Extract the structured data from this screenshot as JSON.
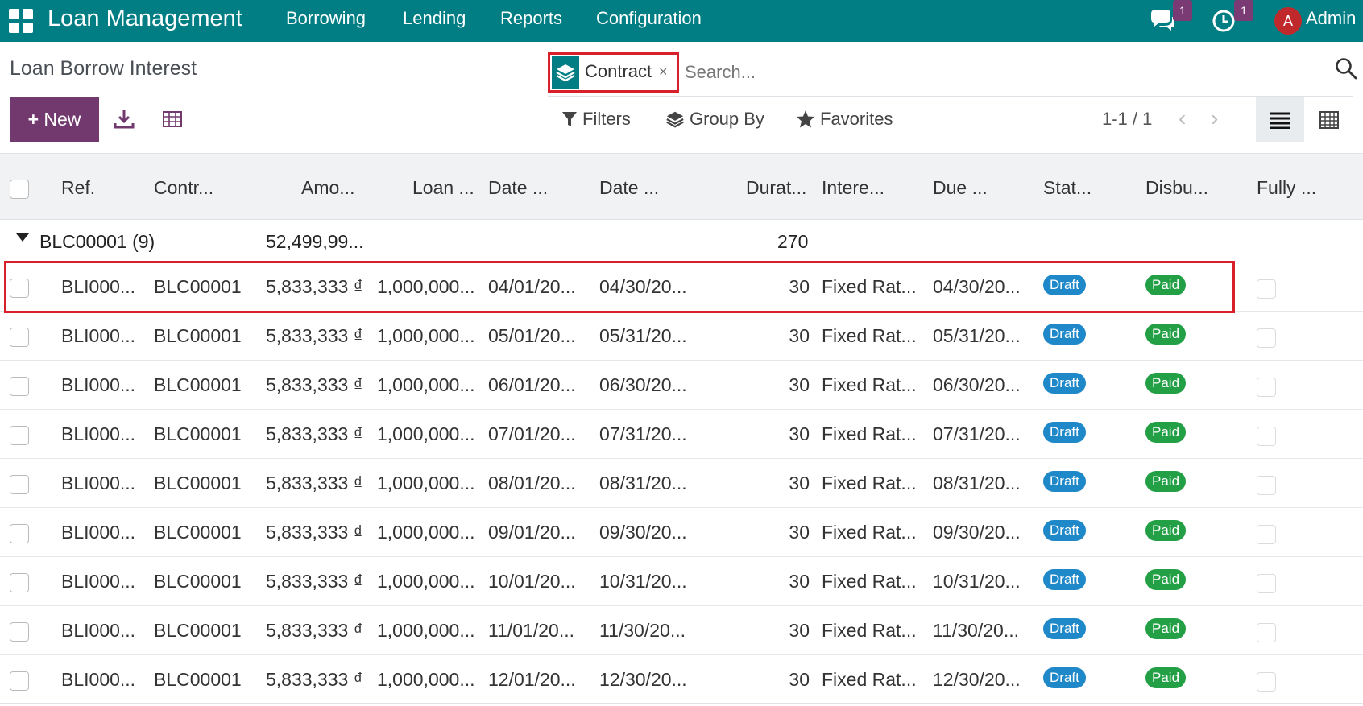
{
  "navbar": {
    "app_title": "Loan Management",
    "menus": [
      "Borrowing",
      "Lending",
      "Reports",
      "Configuration"
    ],
    "messages_badge": "1",
    "activity_badge": "1",
    "avatar_letter": "A",
    "user_name": "Admin",
    "color": "#017e84"
  },
  "control_panel": {
    "title": "Loan Borrow Interest",
    "facet_label": "Contract",
    "facet_close": "×",
    "search_placeholder": "Search...",
    "new_label": "New",
    "filters_label": "Filters",
    "group_by_label": "Group By",
    "favorites_label": "Favorites",
    "pager": "1-1 / 1"
  },
  "table": {
    "headers": [
      "Ref.",
      "Contr...",
      "Amo...",
      "Loan ...",
      "Date ...",
      "Date ...",
      "Durat...",
      "Intere...",
      "Due ...",
      "Stat...",
      "Disbu...",
      "Fully ..."
    ],
    "group": {
      "label": "BLC00001 (9)",
      "amount_total": "52,499,99...",
      "duration_total": "270"
    },
    "rows": [
      {
        "ref": "BLI000...",
        "contract": "BLC00001",
        "amount": "5,833,333 ₫",
        "loan": "1,000,000...",
        "date_from": "04/01/20...",
        "date_to": "04/30/20...",
        "duration": "30",
        "interest": "Fixed Rat...",
        "due": "04/30/20...",
        "state": "Draft",
        "disbursement": "Paid"
      },
      {
        "ref": "BLI000...",
        "contract": "BLC00001",
        "amount": "5,833,333 ₫",
        "loan": "1,000,000...",
        "date_from": "05/01/20...",
        "date_to": "05/31/20...",
        "duration": "30",
        "interest": "Fixed Rat...",
        "due": "05/31/20...",
        "state": "Draft",
        "disbursement": "Paid"
      },
      {
        "ref": "BLI000...",
        "contract": "BLC00001",
        "amount": "5,833,333 ₫",
        "loan": "1,000,000...",
        "date_from": "06/01/20...",
        "date_to": "06/30/20...",
        "duration": "30",
        "interest": "Fixed Rat...",
        "due": "06/30/20...",
        "state": "Draft",
        "disbursement": "Paid"
      },
      {
        "ref": "BLI000...",
        "contract": "BLC00001",
        "amount": "5,833,333 ₫",
        "loan": "1,000,000...",
        "date_from": "07/01/20...",
        "date_to": "07/31/20...",
        "duration": "30",
        "interest": "Fixed Rat...",
        "due": "07/31/20...",
        "state": "Draft",
        "disbursement": "Paid"
      },
      {
        "ref": "BLI000...",
        "contract": "BLC00001",
        "amount": "5,833,333 ₫",
        "loan": "1,000,000...",
        "date_from": "08/01/20...",
        "date_to": "08/31/20...",
        "duration": "30",
        "interest": "Fixed Rat...",
        "due": "08/31/20...",
        "state": "Draft",
        "disbursement": "Paid"
      },
      {
        "ref": "BLI000...",
        "contract": "BLC00001",
        "amount": "5,833,333 ₫",
        "loan": "1,000,000...",
        "date_from": "09/01/20...",
        "date_to": "09/30/20...",
        "duration": "30",
        "interest": "Fixed Rat...",
        "due": "09/30/20...",
        "state": "Draft",
        "disbursement": "Paid"
      },
      {
        "ref": "BLI000...",
        "contract": "BLC00001",
        "amount": "5,833,333 ₫",
        "loan": "1,000,000...",
        "date_from": "10/01/20...",
        "date_to": "10/31/20...",
        "duration": "30",
        "interest": "Fixed Rat...",
        "due": "10/31/20...",
        "state": "Draft",
        "disbursement": "Paid"
      },
      {
        "ref": "BLI000...",
        "contract": "BLC00001",
        "amount": "5,833,333 ₫",
        "loan": "1,000,000...",
        "date_from": "11/01/20...",
        "date_to": "11/30/20...",
        "duration": "30",
        "interest": "Fixed Rat...",
        "due": "11/30/20...",
        "state": "Draft",
        "disbursement": "Paid"
      },
      {
        "ref": "BLI000...",
        "contract": "BLC00001",
        "amount": "5,833,333 ₫",
        "loan": "1,000,000...",
        "date_from": "12/01/20...",
        "date_to": "12/30/20...",
        "duration": "30",
        "interest": "Fixed Rat...",
        "due": "12/30/20...",
        "state": "Draft",
        "disbursement": "Paid"
      }
    ]
  },
  "colors": {
    "primary": "#71396d",
    "draft": "#1e88c8",
    "paid": "#23a046",
    "highlight": "#d8202a"
  }
}
